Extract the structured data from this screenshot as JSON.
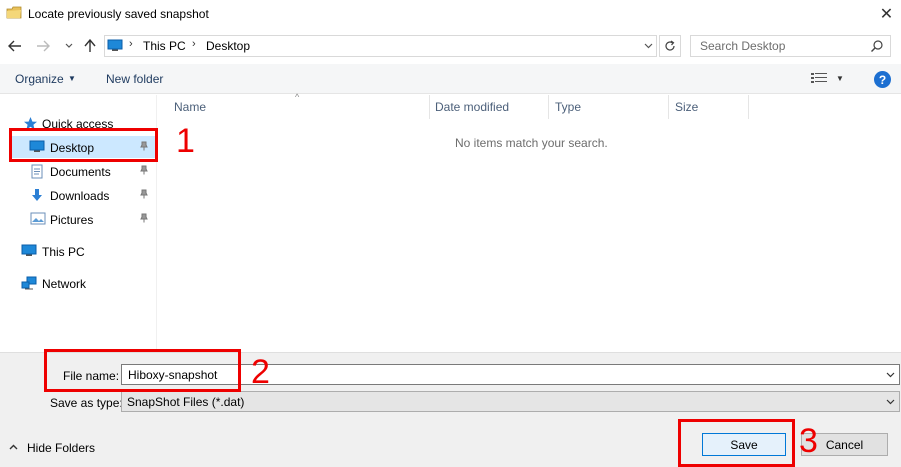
{
  "window": {
    "title": "Locate previously saved snapshot",
    "close_glyph": "✕"
  },
  "nav": {
    "back_icon": "arrow-left-icon",
    "forward_icon": "arrow-right-icon",
    "recent_icon": "chevron-down-icon",
    "up_icon": "arrow-up-icon",
    "breadcrumb": [
      "This PC",
      "Desktop"
    ],
    "refresh_icon": "refresh-icon",
    "search_placeholder": "Search Desktop"
  },
  "commands": {
    "organize": "Organize",
    "new_folder": "New folder"
  },
  "sidebar": {
    "items": [
      {
        "label": "Quick access",
        "icon": "star-icon",
        "pinned": false
      },
      {
        "label": "Desktop",
        "icon": "desktop-icon",
        "pinned": true,
        "selected": true
      },
      {
        "label": "Documents",
        "icon": "documents-icon",
        "pinned": true
      },
      {
        "label": "Downloads",
        "icon": "download-arrow-icon",
        "pinned": true
      },
      {
        "label": "Pictures",
        "icon": "pictures-icon",
        "pinned": true
      },
      {
        "label": "This PC",
        "icon": "computer-icon",
        "pinned": false
      },
      {
        "label": "Network",
        "icon": "network-icon",
        "pinned": false
      }
    ]
  },
  "file_list": {
    "columns": [
      "Name",
      "Date modified",
      "Type",
      "Size"
    ],
    "empty_message": "No items match your search."
  },
  "form": {
    "file_name_label": "File name:",
    "file_name_value": "Hiboxy-snapshot",
    "save_type_label": "Save as type:",
    "save_type_value": "SnapShot Files (*.dat)"
  },
  "footer": {
    "hide_folders": "Hide Folders",
    "save": "Save",
    "cancel": "Cancel"
  },
  "annotations": {
    "step1": "1",
    "step2": "2",
    "step3": "3",
    "color": "#ee0000"
  },
  "colors": {
    "selected_bg": "#cce8ff",
    "accent": "#0078d7",
    "panel_bg": "#f0f0f0"
  }
}
